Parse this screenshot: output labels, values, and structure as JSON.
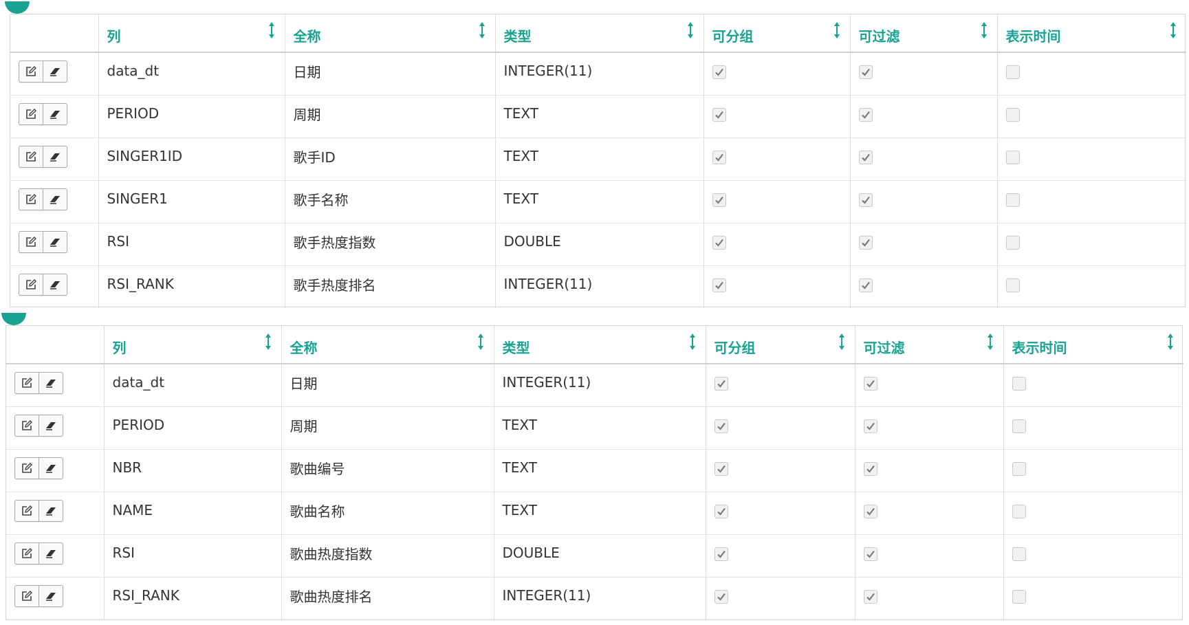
{
  "colors": {
    "accent": "#17a292",
    "border": "#d6d6d6",
    "text": "#333333"
  },
  "icons": {
    "sort": "sort-icon",
    "edit": "edit-icon",
    "eraser": "eraser-icon",
    "check": "check-icon"
  },
  "tables": [
    {
      "headers": [
        "列",
        "全称",
        "类型",
        "可分组",
        "可过滤",
        "表示时间"
      ],
      "rows": [
        {
          "column": "data_dt",
          "fullname": "日期",
          "type": "INTEGER(11)",
          "groupable": true,
          "filterable": true,
          "is_time": false
        },
        {
          "column": "PERIOD",
          "fullname": "周期",
          "type": "TEXT",
          "groupable": true,
          "filterable": true,
          "is_time": false
        },
        {
          "column": "SINGER1ID",
          "fullname": "歌手ID",
          "type": "TEXT",
          "groupable": true,
          "filterable": true,
          "is_time": false
        },
        {
          "column": "SINGER1",
          "fullname": "歌手名称",
          "type": "TEXT",
          "groupable": true,
          "filterable": true,
          "is_time": false
        },
        {
          "column": "RSI",
          "fullname": "歌手热度指数",
          "type": "DOUBLE",
          "groupable": true,
          "filterable": true,
          "is_time": false
        },
        {
          "column": "RSI_RANK",
          "fullname": "歌手热度排名",
          "type": "INTEGER(11)",
          "groupable": true,
          "filterable": true,
          "is_time": false
        }
      ]
    },
    {
      "headers": [
        "列",
        "全称",
        "类型",
        "可分组",
        "可过滤",
        "表示时间"
      ],
      "rows": [
        {
          "column": "data_dt",
          "fullname": "日期",
          "type": "INTEGER(11)",
          "groupable": true,
          "filterable": true,
          "is_time": false
        },
        {
          "column": "PERIOD",
          "fullname": "周期",
          "type": "TEXT",
          "groupable": true,
          "filterable": true,
          "is_time": false
        },
        {
          "column": "NBR",
          "fullname": "歌曲编号",
          "type": "TEXT",
          "groupable": true,
          "filterable": true,
          "is_time": false
        },
        {
          "column": "NAME",
          "fullname": "歌曲名称",
          "type": "TEXT",
          "groupable": true,
          "filterable": true,
          "is_time": false
        },
        {
          "column": "RSI",
          "fullname": "歌曲热度指数",
          "type": "DOUBLE",
          "groupable": true,
          "filterable": true,
          "is_time": false
        },
        {
          "column": "RSI_RANK",
          "fullname": "歌曲热度排名",
          "type": "INTEGER(11)",
          "groupable": true,
          "filterable": true,
          "is_time": false
        }
      ]
    }
  ]
}
